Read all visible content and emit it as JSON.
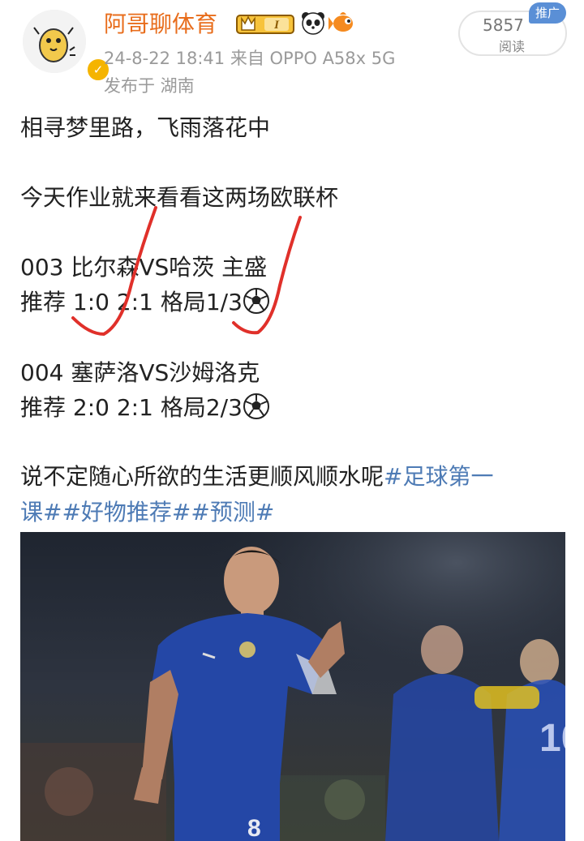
{
  "author": {
    "name": "阿哥聊体育",
    "level_badge": "I",
    "verified_icon": "verified-badge-icon",
    "avatar_icon": "cartoon-potato-avatar"
  },
  "post_meta": {
    "time_source": "24-8-22 18:41   来自 OPPO A58x 5G",
    "location": "发布于 湖南"
  },
  "read_counter": {
    "count": "5857",
    "label": "阅读",
    "promo_tag": "推广"
  },
  "content": {
    "line1": "相寻梦里路，飞雨落花中",
    "line2": "今天作业就来看看这两场欧联杯",
    "match1_title": "003  比尔森VS哈茨   主盛",
    "match1_tip_prefix": "推荐  1:0 2:1     格局1/3",
    "match2_title": "004  塞萨洛VS沙姆洛克",
    "match2_tip_prefix": "推荐  2:0 2:1     格局2/3",
    "closing_text": "说不定随心所欲的生活更顺风顺水呢",
    "hashtag1_a": "#足球第一",
    "hashtag1_b": "课#",
    "hashtag2": "#好物推荐#",
    "hashtag3": "#预测#",
    "soccer_icon": "soccer-ball-icon"
  },
  "photo": {
    "subject_number": "8",
    "description_icon": "football-player-photo"
  },
  "colors": {
    "username": "#e86d1c",
    "hashtag": "#4e7bb5",
    "meta_text": "#9a9a9a",
    "red_checkmark": "#e0302a",
    "promo_bg": "#5a8fd6"
  }
}
